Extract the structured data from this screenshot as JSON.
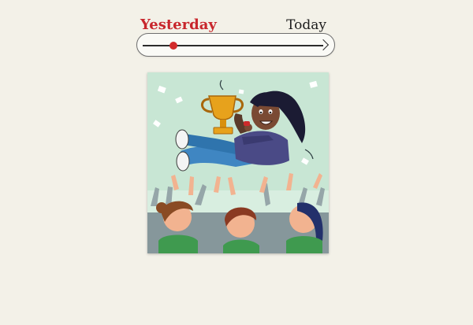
{
  "timeline": {
    "start_label": "Yesterday",
    "end_label": "Today",
    "position_fraction": 0.17,
    "track_icon": "arrow-right-icon",
    "thumb_color": "#d22b2b",
    "start_label_color": "#c8262c"
  },
  "illustration": {
    "background_color": "#c8e6d4",
    "icons": [
      "trophy-icon",
      "whistle-icon",
      "confetti-icon"
    ]
  }
}
